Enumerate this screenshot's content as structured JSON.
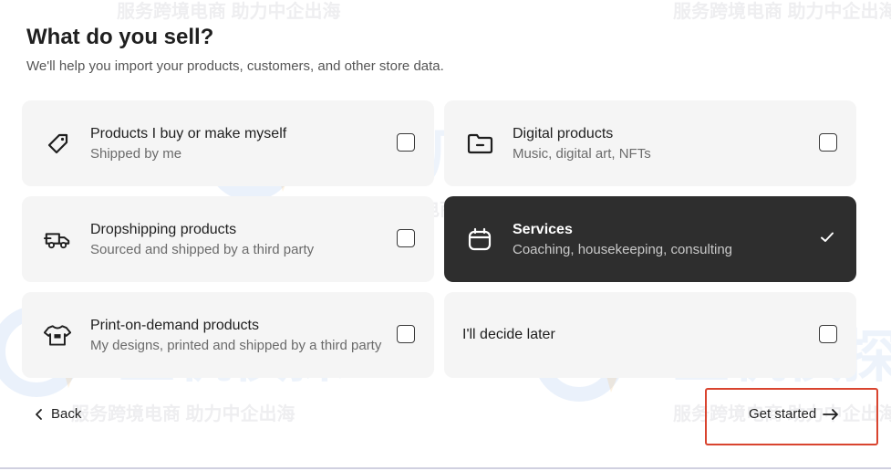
{
  "header": {
    "title": "What do you sell?",
    "subtitle": "We'll help you import your products, customers, and other store data."
  },
  "options": [
    {
      "label": "Products I buy or make myself",
      "desc": "Shipped by me",
      "icon": "tag-icon",
      "selected": false
    },
    {
      "label": "Digital products",
      "desc": "Music, digital art, NFTs",
      "icon": "folder-icon",
      "selected": false
    },
    {
      "label": "Dropshipping products",
      "desc": "Sourced and shipped by a third party",
      "icon": "truck-icon",
      "selected": false
    },
    {
      "label": "Services",
      "desc": "Coaching, housekeeping, consulting",
      "icon": "calendar-icon",
      "selected": true
    },
    {
      "label": "Print-on-demand products",
      "desc": "My designs, printed and shipped by a third party",
      "icon": "shirt-icon",
      "selected": false
    },
    {
      "label": "I'll decide later",
      "desc": "",
      "icon": "",
      "selected": false
    }
  ],
  "footer": {
    "back_label": "Back",
    "get_started_label": "Get started"
  },
  "watermark": {
    "text": "服务跨境电商 助力中企出海",
    "logo_text": "主机侦探"
  },
  "colors": {
    "selected_card": "#2e2e2e",
    "card": "#f5f5f5",
    "highlight": "#d9442f"
  }
}
